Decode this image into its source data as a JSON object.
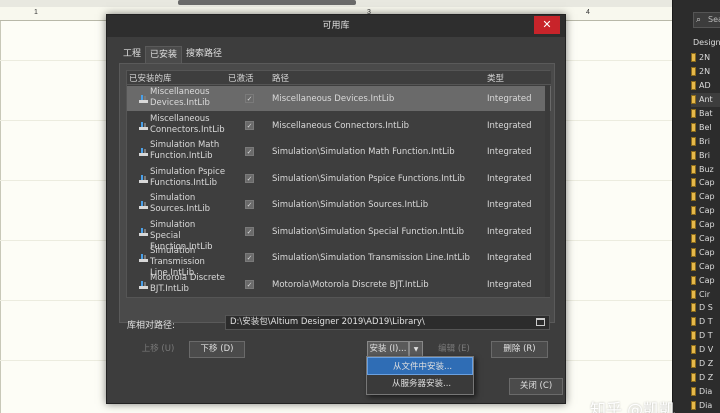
{
  "ruler_ticks": [
    "1",
    "3",
    "4"
  ],
  "dialog": {
    "title": "可用库",
    "close_glyph": "✕",
    "tabs": [
      {
        "label": "工程",
        "active": false
      },
      {
        "label": "已安装",
        "active": true
      },
      {
        "label": "搜索路径",
        "active": false
      }
    ],
    "columns": {
      "lib": "已安装的库",
      "active": "已激活",
      "path": "路径",
      "type": "类型"
    },
    "rows": [
      {
        "name": "Miscellaneous Devices.IntLib",
        "active": true,
        "path": "Miscellaneous Devices.IntLib",
        "type": "Integrated",
        "selected": true
      },
      {
        "name": "Miscellaneous Connectors.IntLib",
        "active": true,
        "path": "Miscellaneous Connectors.IntLib",
        "type": "Integrated",
        "selected": false
      },
      {
        "name": "Simulation Math Function.IntLib",
        "active": true,
        "path": "Simulation\\Simulation Math Function.IntLib",
        "type": "Integrated",
        "selected": false
      },
      {
        "name": "Simulation Pspice Functions.IntLib",
        "active": true,
        "path": "Simulation\\Simulation Pspice Functions.IntLib",
        "type": "Integrated",
        "selected": false
      },
      {
        "name": "Simulation Sources.IntLib",
        "active": true,
        "path": "Simulation\\Simulation Sources.IntLib",
        "type": "Integrated",
        "selected": false
      },
      {
        "name": "Simulation Special Function.IntLib",
        "active": true,
        "path": "Simulation\\Simulation Special Function.IntLib",
        "type": "Integrated",
        "selected": false
      },
      {
        "name": "Simulation Transmission Line.IntLib",
        "active": true,
        "path": "Simulation\\Simulation Transmission Line.IntLib",
        "type": "Integrated",
        "selected": false
      },
      {
        "name": "Motorola Discrete BJT.IntLib",
        "active": true,
        "path": "Motorola\\Motorola Discrete BJT.IntLib",
        "type": "Integrated",
        "selected": false
      }
    ],
    "relative_path_label": "库相对路径:",
    "relative_path_value": "D:\\安装包\\Altium Designer 2019\\AD19\\Library\\",
    "buttons": {
      "move_up": "上移 (U)",
      "move_down": "下移 (D)",
      "install": "安装 (I)...",
      "install_arrow": "▼",
      "edit": "编辑 (E)",
      "remove": "删除 (R)",
      "close": "关闭 (C)"
    },
    "install_menu": [
      {
        "label": "从文件中安装...",
        "highlighted": true
      },
      {
        "label": "从服务器安装...",
        "highlighted": false
      }
    ]
  },
  "side_panel": {
    "search_placeholder": "Sea",
    "header": "Design",
    "items": [
      "2N",
      "2N",
      "AD",
      "Ant",
      "Bat",
      "Bel",
      "Bri",
      "Bri",
      "Buz",
      "Cap",
      "Cap",
      "Cap",
      "Cap",
      "Cap",
      "Cap",
      "Cap",
      "Cap",
      "Cir",
      "D S",
      "D T",
      "D T",
      "D V",
      "D Z",
      "D Z",
      "Dia",
      "Dia"
    ],
    "selected_index": 3
  },
  "watermark": "知乎 @凱凱"
}
